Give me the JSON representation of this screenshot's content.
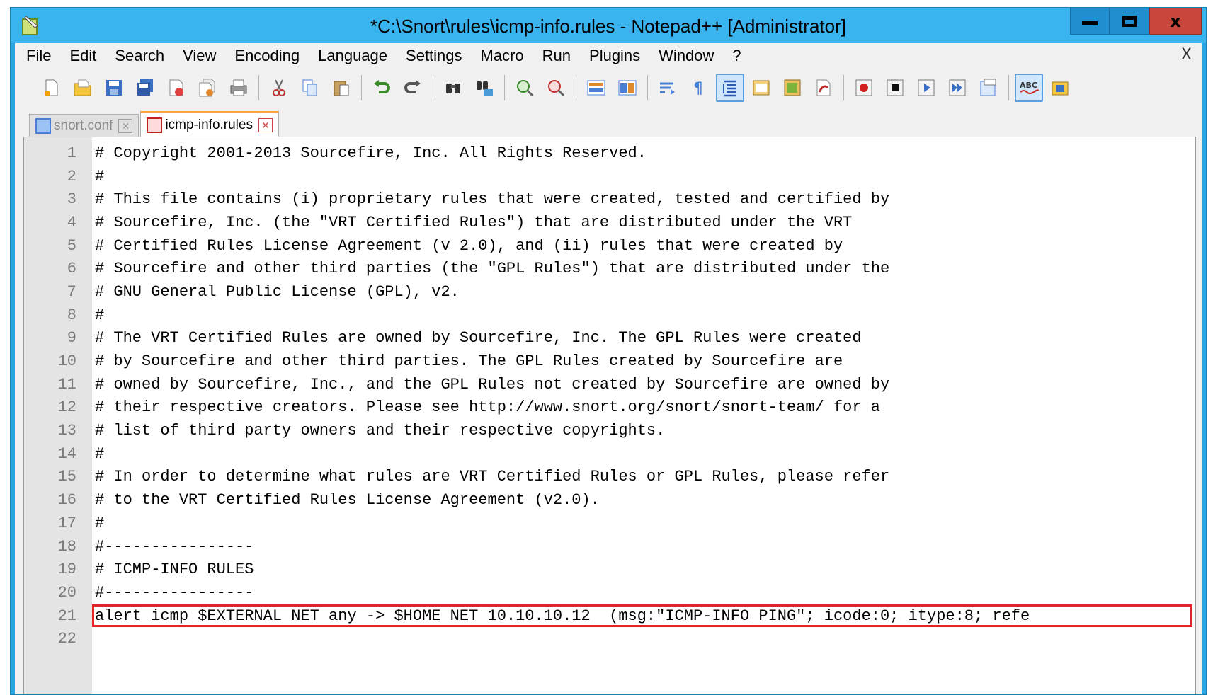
{
  "window": {
    "title": "*C:\\Snort\\rules\\icmp-info.rules - Notepad++ [Administrator]",
    "controls": {
      "minimize": "minimize",
      "maximize": "maximize",
      "close": "x"
    }
  },
  "menu": {
    "items": [
      "File",
      "Edit",
      "Search",
      "View",
      "Encoding",
      "Language",
      "Settings",
      "Macro",
      "Run",
      "Plugins",
      "Window",
      "?"
    ],
    "close_label": "X"
  },
  "toolbar": {
    "icons": [
      "new-file-icon",
      "open-file-icon",
      "save-icon",
      "save-all-icon",
      "close-icon",
      "close-all-icon",
      "print-icon",
      "cut-icon",
      "copy-icon",
      "paste-icon",
      "undo-icon",
      "redo-icon",
      "find-icon",
      "replace-icon",
      "zoom-in-icon",
      "zoom-out-icon",
      "sync-vertical-icon",
      "sync-horizontal-icon",
      "word-wrap-icon",
      "show-all-chars-icon",
      "indent-guide-icon",
      "doc-map-icon",
      "function-list-icon",
      "folder-workspace-icon",
      "record-macro-icon",
      "stop-record-icon",
      "play-macro-icon",
      "run-macro-multiple-icon",
      "save-macro-icon",
      "spell-check-icon",
      "plugin-icon"
    ]
  },
  "tabs": [
    {
      "label": "snort.conf",
      "active": false
    },
    {
      "label": "icmp-info.rules",
      "active": true
    }
  ],
  "editor": {
    "lines": [
      {
        "n": "1",
        "text": "# Copyright 2001-2013 Sourcefire, Inc. All Rights Reserved."
      },
      {
        "n": "2",
        "text": "#"
      },
      {
        "n": "3",
        "text": "# This file contains (i) proprietary rules that were created, tested and certified by"
      },
      {
        "n": "4",
        "text": "# Sourcefire, Inc. (the \"VRT Certified Rules\") that are distributed under the VRT"
      },
      {
        "n": "5",
        "text": "# Certified Rules License Agreement (v 2.0), and (ii) rules that were created by"
      },
      {
        "n": "6",
        "text": "# Sourcefire and other third parties (the \"GPL Rules\") that are distributed under the"
      },
      {
        "n": "7",
        "text": "# GNU General Public License (GPL), v2."
      },
      {
        "n": "8",
        "text": "#"
      },
      {
        "n": "9",
        "text": "# The VRT Certified Rules are owned by Sourcefire, Inc. The GPL Rules were created"
      },
      {
        "n": "10",
        "text": "# by Sourcefire and other third parties. The GPL Rules created by Sourcefire are"
      },
      {
        "n": "11",
        "text": "# owned by Sourcefire, Inc., and the GPL Rules not created by Sourcefire are owned by"
      },
      {
        "n": "12",
        "text": "# their respective creators. Please see http://www.snort.org/snort/snort-team/ for a"
      },
      {
        "n": "13",
        "text": "# list of third party owners and their respective copyrights."
      },
      {
        "n": "14",
        "text": "#"
      },
      {
        "n": "15",
        "text": "# In order to determine what rules are VRT Certified Rules or GPL Rules, please refer"
      },
      {
        "n": "16",
        "text": "# to the VRT Certified Rules License Agreement (v2.0)."
      },
      {
        "n": "17",
        "text": "#"
      },
      {
        "n": "18",
        "text": "#----------------"
      },
      {
        "n": "19",
        "text": "# ICMP-INFO RULES"
      },
      {
        "n": "20",
        "text": "#----------------"
      },
      {
        "n": "21",
        "text": "alert icmp $EXTERNAL NET any -> $HOME NET 10.10.10.12  (msg:\"ICMP-INFO PING\"; icode:0; itype:8; refe"
      },
      {
        "n": "22",
        "text": ""
      }
    ],
    "highlighted_line": "21"
  },
  "colors": {
    "titlebar": "#3ab4ee",
    "highlight_border": "#e0252b",
    "gutter": "#e4e4e4"
  }
}
